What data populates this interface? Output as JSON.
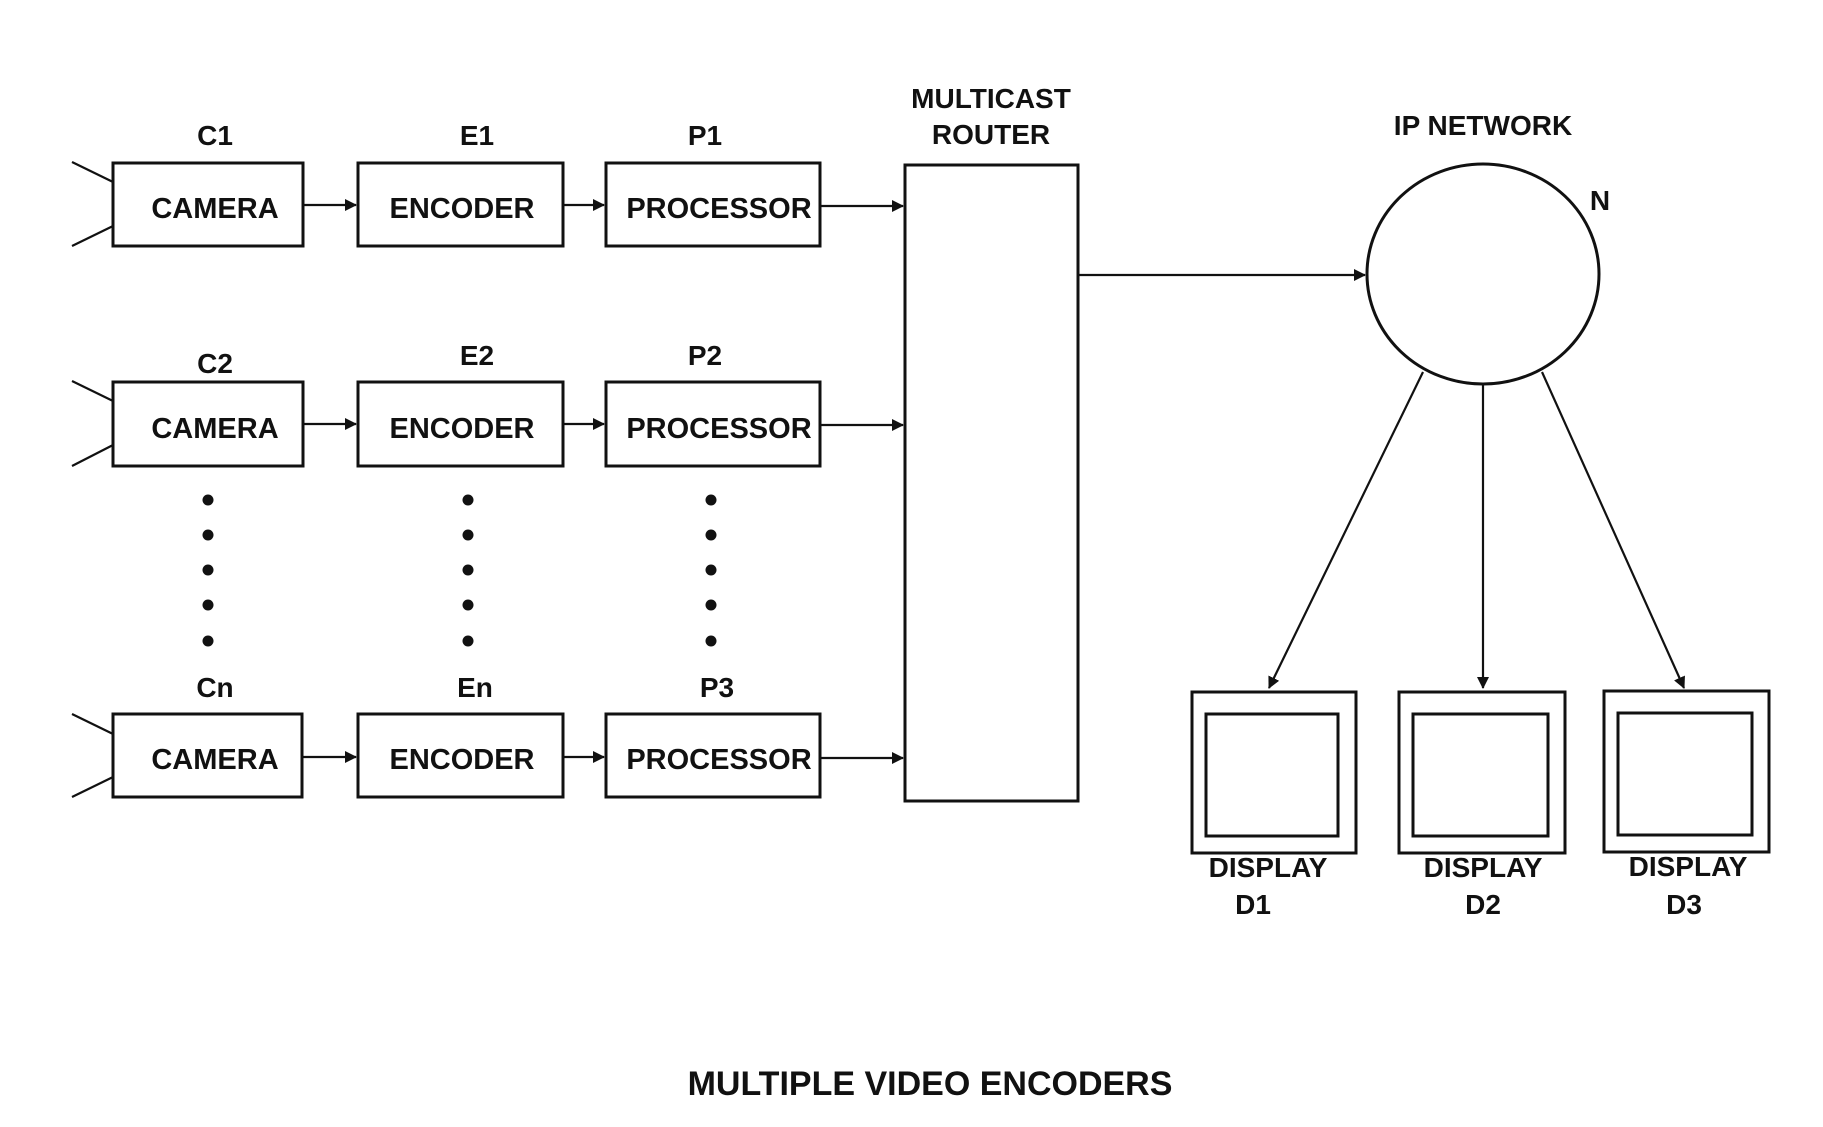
{
  "diagram": {
    "title": "MULTIPLE VIDEO ENCODERS",
    "router": {
      "label_line1": "MULTICAST",
      "label_line2": "ROUTER"
    },
    "network": {
      "label": "IP NETWORK",
      "ref": "N"
    },
    "rows": [
      {
        "camera": {
          "ref": "C1",
          "label": "CAMERA"
        },
        "encoder": {
          "ref": "E1",
          "label": "ENCODER"
        },
        "processor": {
          "ref": "P1",
          "label": "PROCESSOR"
        }
      },
      {
        "camera": {
          "ref": "C2",
          "label": "CAMERA"
        },
        "encoder": {
          "ref": "E2",
          "label": "ENCODER"
        },
        "processor": {
          "ref": "P2",
          "label": "PROCESSOR"
        }
      },
      {
        "camera": {
          "ref": "Cn",
          "label": "CAMERA"
        },
        "encoder": {
          "ref": "En",
          "label": "ENCODER"
        },
        "processor": {
          "ref": "P3",
          "label": "PROCESSOR"
        }
      }
    ],
    "displays": [
      {
        "label": "DISPLAY",
        "ref": "D1"
      },
      {
        "label": "DISPLAY",
        "ref": "D2"
      },
      {
        "label": "DISPLAY",
        "ref": "D3"
      }
    ],
    "ellipsis_dots_per_column": 5
  }
}
